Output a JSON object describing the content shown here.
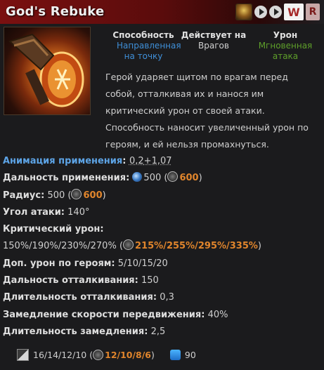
{
  "header": {
    "title": "God's Rebuke",
    "keys": [
      "W",
      "R"
    ]
  },
  "meta": {
    "ability_label": "Способность",
    "ability_value": "Направленная на точку",
    "affects_label": "Действует на",
    "affects_value": "Врагов",
    "damage_label": "Урон",
    "damage_value": "Мгновенная атака"
  },
  "description": "Герой ударяет щитом по врагам перед собой, отталкивая их и нанося им критический урон от своей атаки. Способность наносит увеличенный урон по героям, и ей нельзя промахнуться.",
  "stats": {
    "cast_anim_label": "Анимация применения",
    "cast_anim_value_a": "0,2",
    "cast_anim_value_b": "+1,07",
    "cast_range_label": "Дальность применения:",
    "cast_range_value": "500",
    "cast_range_scepter": "600",
    "radius_label": "Радиус:",
    "radius_value": "500",
    "radius_scepter": "600",
    "angle_label": "Угол атаки:",
    "angle_value": "140°",
    "crit_label": "Критический урон:",
    "crit_value": "150%/190%/230%/270%",
    "crit_scepter": "215%/255%/295%/335%",
    "hero_dmg_label": "Доп. урон по героям:",
    "hero_dmg_value": "5/10/15/20",
    "kb_dist_label": "Дальность отталкивания:",
    "kb_dist_value": "150",
    "kb_dur_label": "Длительность отталкивания:",
    "kb_dur_value": "0,3",
    "slow_label": "Замедление скорости передвижения:",
    "slow_value": "40%",
    "slow_dur_label": "Длительность замедления:",
    "slow_dur_value": "2,5"
  },
  "footer": {
    "cooldown": "16/14/12/10",
    "cooldown_scepter": "12/10/8/6",
    "mana": "90"
  },
  "colors": {
    "header_red": "#7a1010",
    "accent_orange": "#e0852c",
    "link_blue": "#3f8fd8",
    "instant_green": "#5e9f2a"
  }
}
